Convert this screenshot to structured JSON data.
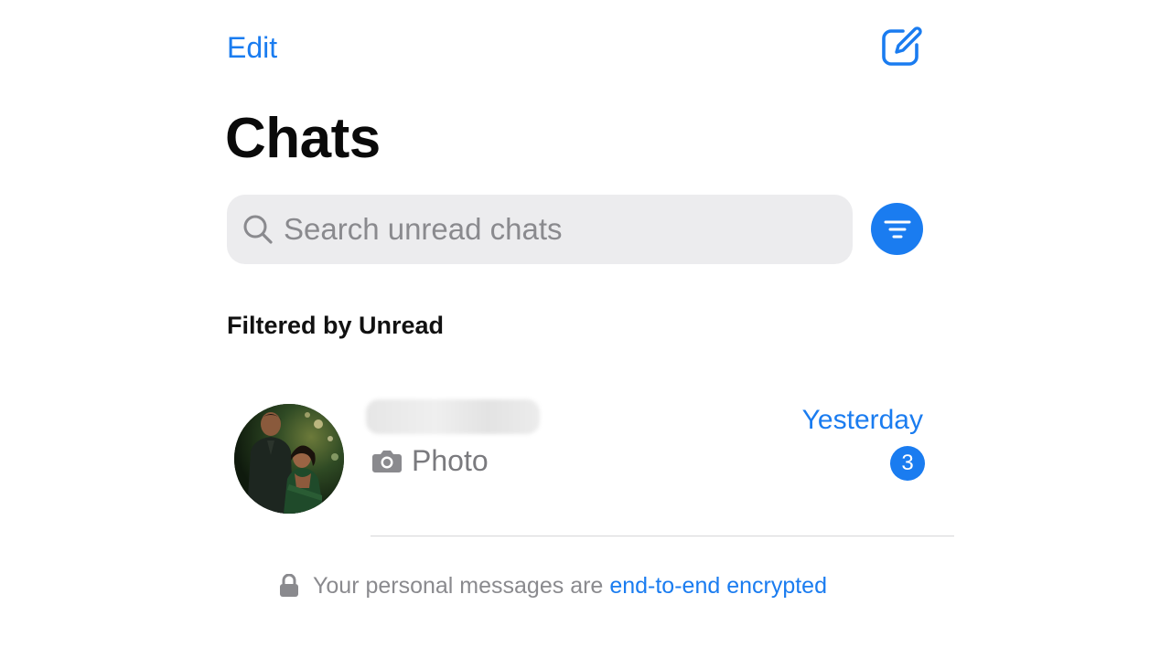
{
  "colors": {
    "accent": "#1a7cf0",
    "search_bg": "#ececee"
  },
  "header": {
    "edit_label": "Edit",
    "compose_icon": "compose-icon",
    "title": "Chats"
  },
  "search": {
    "placeholder": "Search unread chats",
    "value": "",
    "icon": "search-icon"
  },
  "filter": {
    "icon": "filter-icon",
    "section_label": "Filtered by Unread"
  },
  "chats": [
    {
      "name": "",
      "name_redacted": true,
      "preview_icon": "camera-icon",
      "preview": "Photo",
      "time": "Yesterday",
      "unread_count": "3"
    }
  ],
  "footer": {
    "lock_icon": "lock-icon",
    "text": "Your personal messages are",
    "link": "end-to-end encrypted"
  }
}
